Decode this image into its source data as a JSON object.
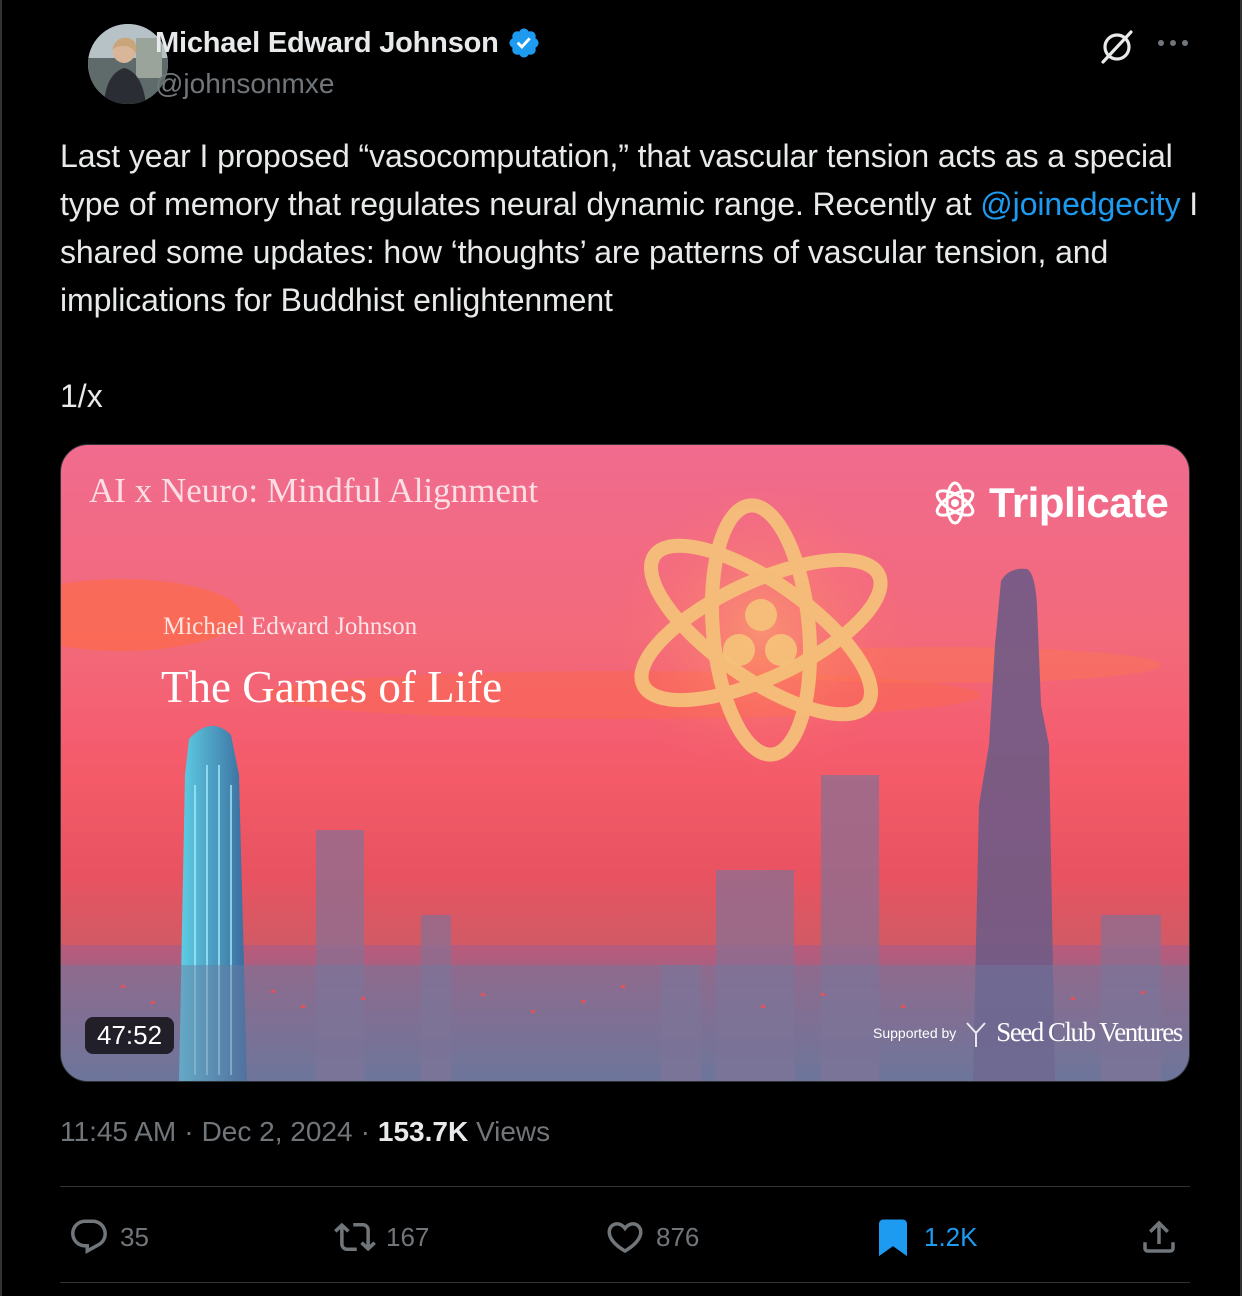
{
  "author": {
    "name": "Michael Edward Johnson",
    "handle": "@johnsonmxe",
    "verified": true,
    "avatar_icon": "avatar-photo"
  },
  "header_icons": [
    "grok-icon",
    "more-icon"
  ],
  "post": {
    "text_before_mention": "Last year I proposed “vasocomputation,” that vascular tension acts as a special type of memory that regulates neural dynamic range. Recently at ",
    "mention": "@joinedgecity",
    "text_after_mention": " I shared some updates: how ‘thoughts’ are patterns of vascular tension, and implications for Buddhist enlightenment",
    "thread_marker": "1/x"
  },
  "media": {
    "series": "AI x Neuro: Mindful Alignment",
    "brand": "Triplicate",
    "speaker": "Michael Edward Johnson",
    "title": "The Games of Life",
    "duration": "47:52",
    "sponsor_label": "Supported by",
    "sponsor_name": "Seed Club Ventures"
  },
  "meta": {
    "time": "11:45 AM",
    "separator": "·",
    "date": "Dec 2, 2024",
    "views_count": "153.7K",
    "views_label": "Views"
  },
  "actions": {
    "replies": "35",
    "reposts": "167",
    "likes": "876",
    "bookmarks": "1.2K"
  },
  "colors": {
    "background": "#000000",
    "text": "#e7e9ea",
    "muted": "#71767b",
    "accent": "#1d9bf0",
    "border": "#2f3336"
  }
}
